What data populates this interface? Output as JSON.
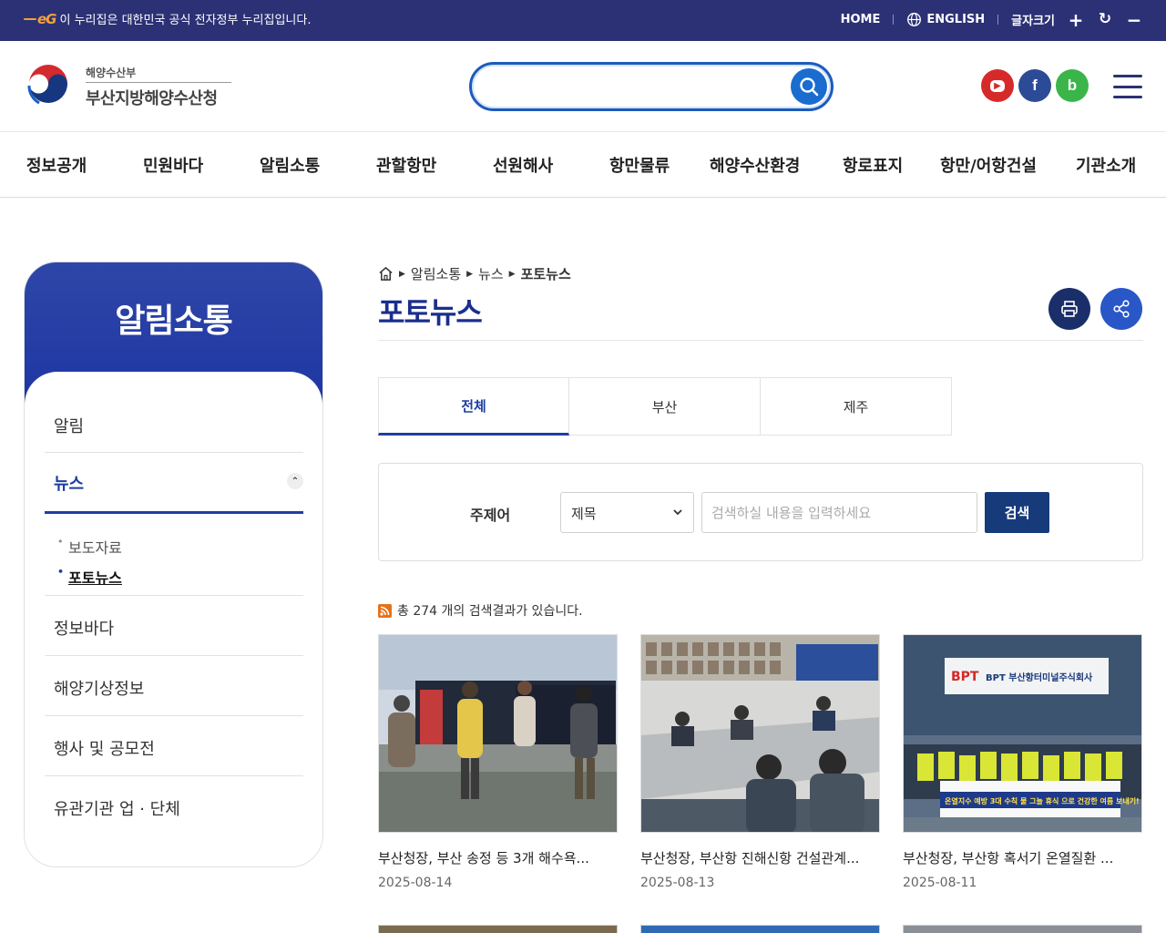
{
  "gov_bar": {
    "mark": "eG",
    "notice": "이 누리집은 대한민국 공식 전자정부 누리집입니다.",
    "home": "HOME",
    "english": "ENGLISH",
    "font_size": "글자크기",
    "increase": "+",
    "reset": "↻",
    "decrease": "−"
  },
  "header": {
    "ministry": "해양수산부",
    "office": "부산지방해양수산청",
    "search_placeholder": "",
    "sns": {
      "youtube": "▶",
      "facebook": "f",
      "blog": "b"
    }
  },
  "gnb": [
    "정보공개",
    "민원바다",
    "알림소통",
    "관할항만",
    "선원해사",
    "항만물류",
    "해양수산환경",
    "항로표지",
    "항만/어항건설",
    "기관소개"
  ],
  "sidebar": {
    "title": "알림소통",
    "items": [
      "알림",
      "뉴스",
      "정보바다",
      "해양기상정보",
      "행사 및 공모전",
      "유관기관 업 · 단체"
    ],
    "toggle": "⌃",
    "sub_items": [
      "보도자료",
      "포토뉴스"
    ]
  },
  "breadcrumb": [
    "알림소통",
    "뉴스",
    "포토뉴스"
  ],
  "page_title": "포토뉴스",
  "tabs": [
    "전체",
    "부산",
    "제주"
  ],
  "search": {
    "label": "주제어",
    "select_value": "제목",
    "placeholder": "검색하실 내용을 입력하세요",
    "button": "검색"
  },
  "result_text": "총 274 개의 검색결과가 있습니다.",
  "cards": [
    {
      "title": "부산청장, 부산 송정 등 3개 해수욕...",
      "date": "2025-08-14"
    },
    {
      "title": "부산청장, 부산항 진해신항 건설관계...",
      "date": "2025-08-13"
    },
    {
      "title": "부산청장, 부산항 혹서기 온열질환 ...",
      "date": "2025-08-11"
    }
  ],
  "photo_text": {
    "card3_sign": "BPT 부산항터미널주식회사",
    "card3_banner": "온열지수 예방 3대 수칙 물 그늘 휴식 으로 건강한 여름 보내기!"
  },
  "colors": {
    "gov_bar": "#2c3175",
    "primary": "#1e3ea0",
    "search_border": "#1b5bbd",
    "search_button": "#173a7a"
  }
}
